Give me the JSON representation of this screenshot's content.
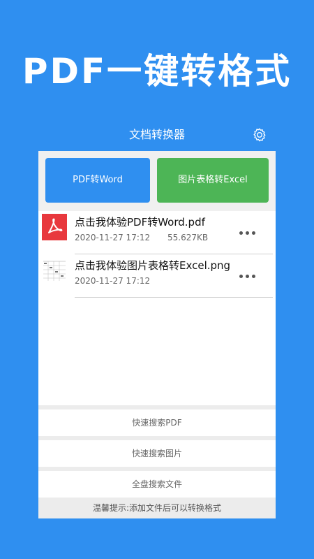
{
  "promo": {
    "title": "PDF一键转格式"
  },
  "appbar": {
    "title": "文档转换器",
    "settings_icon": "gear-icon"
  },
  "actions": {
    "pdf_to_word": "PDF转Word",
    "image_table_to_excel": "图片表格转Excel"
  },
  "files": [
    {
      "name": "点击我体验PDF转Word.pdf",
      "date": "2020-11-27 17:12",
      "size": "55.627KB",
      "icon": "pdf-icon"
    },
    {
      "name": "点击我体验图片表格转Excel.png",
      "date": "2020-11-27 17:12",
      "size": "",
      "icon": "image-thumbnail-icon"
    }
  ],
  "search": {
    "pdf": "快速搜索PDF",
    "images": "快速搜索图片",
    "all_files": "全盘搜索文件"
  },
  "tip": "温馨提示:添加文件后可以转换格式",
  "colors": {
    "primary_blue": "#2f8ff0",
    "excel_green": "#4db556",
    "pdf_red": "#e8383d"
  }
}
